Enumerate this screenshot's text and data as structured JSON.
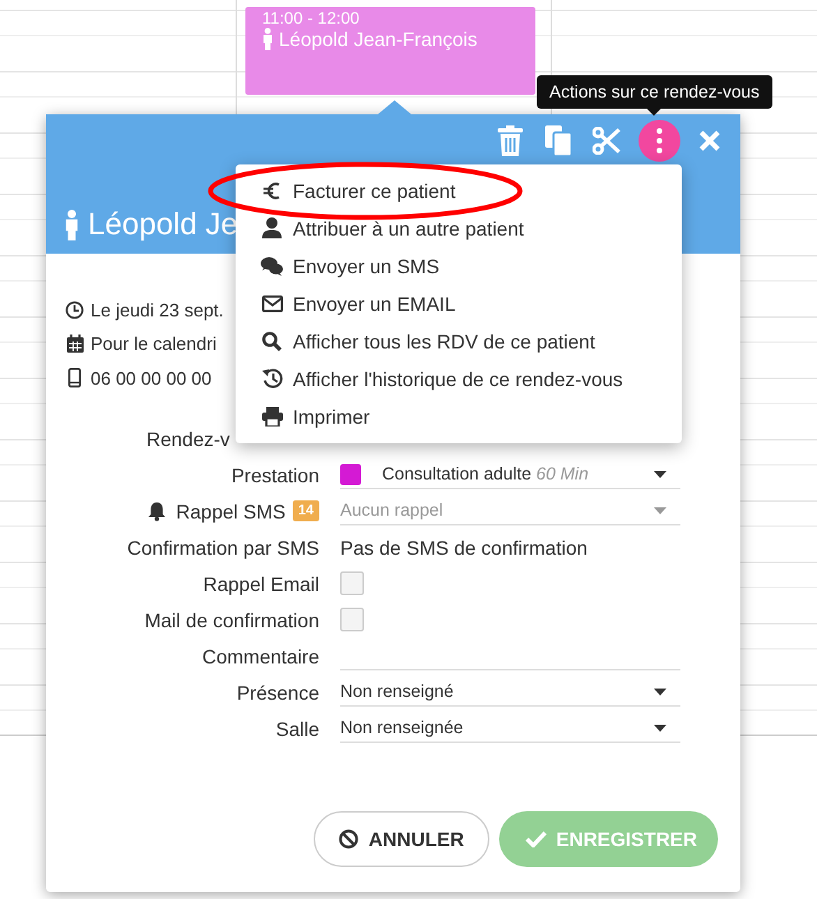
{
  "event": {
    "time": "11:00 - 12:00",
    "patient": "Léopold Jean-François",
    "color": "#e88ae8"
  },
  "tooltip": "Actions sur ce rendez-vous",
  "toolbar": [
    {
      "kind": "trash"
    },
    {
      "kind": "copy"
    },
    {
      "kind": "cut"
    },
    {
      "kind": "more",
      "selected": true
    },
    {
      "kind": "close"
    }
  ],
  "popup": {
    "title": "Léopold Je",
    "info": [
      {
        "kind": "clock",
        "text": "Le jeudi 23 sept."
      },
      {
        "kind": "calendar",
        "text": "Pour le calendri"
      },
      {
        "kind": "phone",
        "text": "06 00 00 00 00"
      }
    ]
  },
  "menu": {
    "items": [
      {
        "kind": "euro",
        "label": "Facturer ce patient",
        "circled": true
      },
      {
        "kind": "user",
        "label": "Attribuer à un autre patient",
        "circled": false
      },
      {
        "kind": "chat",
        "label": "Envoyer un SMS",
        "circled": false
      },
      {
        "kind": "mail",
        "label": "Envoyer un EMAIL",
        "circled": false
      },
      {
        "kind": "search",
        "label": "Afficher tous les RDV de ce patient",
        "circled": false
      },
      {
        "kind": "history",
        "label": "Afficher l'historique de ce rendez-vous",
        "circled": false
      },
      {
        "kind": "print",
        "label": "Imprimer",
        "circled": false
      }
    ]
  },
  "form": [
    {
      "kind": "covered",
      "label": "Rendez-v"
    },
    {
      "kind": "select",
      "label": "Prestation",
      "color": "#d41ad4",
      "value": "Consultation adulte",
      "note": "60 Min"
    },
    {
      "kind": "reminder",
      "label": "Rappel SMS",
      "badge": "14",
      "placeholder": "Aucun rappel"
    },
    {
      "kind": "text",
      "label": "Confirmation par SMS",
      "value": "Pas de SMS de confirmation"
    },
    {
      "kind": "checkbox",
      "label": "Rappel Email",
      "checked": false
    },
    {
      "kind": "checkbox",
      "label": "Mail de confirmation",
      "checked": false
    },
    {
      "kind": "input",
      "label": "Commentaire"
    },
    {
      "kind": "select",
      "label": "Présence",
      "value": "Non renseigné"
    },
    {
      "kind": "select",
      "label": "Salle",
      "value": "Non renseignée"
    }
  ],
  "buttons": [
    {
      "kind": "cancel",
      "label": "ANNULER"
    },
    {
      "kind": "save",
      "label": "ENREGISTRER"
    }
  ]
}
